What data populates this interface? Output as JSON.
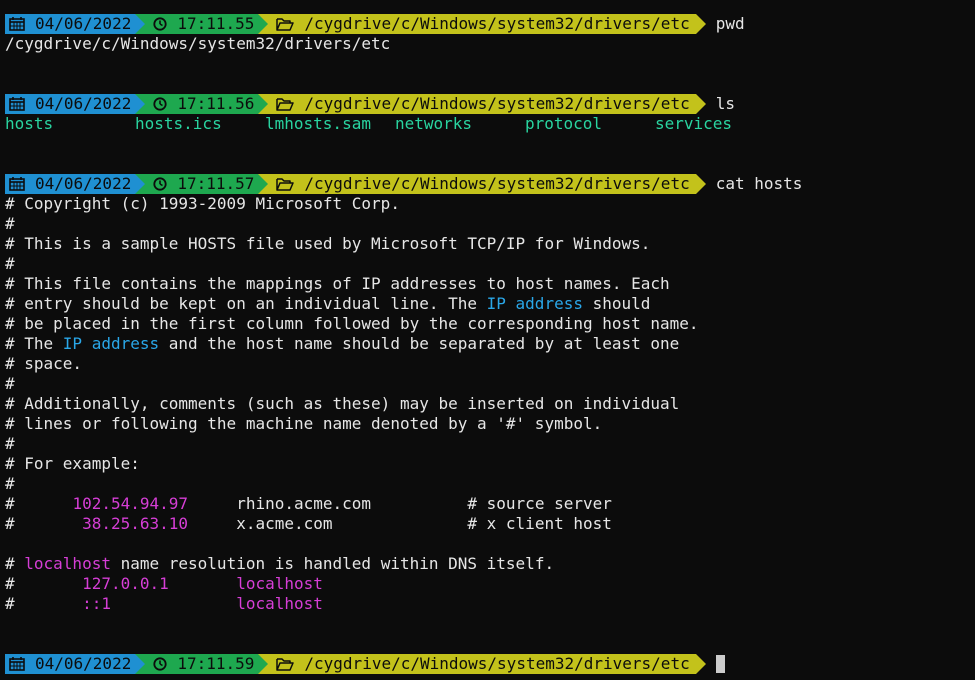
{
  "colors": {
    "date_segment": "#1f90d2",
    "time_segment": "#1ea84f",
    "path_segment": "#c3c21b",
    "file_name": "#29d4a0",
    "ip_highlight": "#2aa7e8",
    "value_highlight": "#d63ed6",
    "background": "#0c0c0c"
  },
  "prompts": [
    {
      "date": "04/06/2022",
      "time": "17:11.55",
      "path": "/cygdrive/c/Windows/system32/drivers/etc",
      "command": "pwd"
    },
    {
      "date": "04/06/2022",
      "time": "17:11.56",
      "path": "/cygdrive/c/Windows/system32/drivers/etc",
      "command": "ls"
    },
    {
      "date": "04/06/2022",
      "time": "17:11.57",
      "path": "/cygdrive/c/Windows/system32/drivers/etc",
      "command": "cat hosts"
    },
    {
      "date": "04/06/2022",
      "time": "17:11.59",
      "path": "/cygdrive/c/Windows/system32/drivers/etc",
      "command": ""
    }
  ],
  "pwd_output": "/cygdrive/c/Windows/system32/drivers/etc",
  "ls_output": [
    "hosts",
    "hosts.ics",
    "lmhosts.sam",
    "networks",
    "protocol",
    "services"
  ],
  "hosts_file": {
    "l1": "# Copyright (c) 1993-2009 Microsoft Corp.",
    "l2": "#",
    "l3": "# This is a sample HOSTS file used by Microsoft TCP/IP for Windows.",
    "l4": "#",
    "l5": "# This file contains the mappings of IP addresses to host names. Each",
    "l6a": "# entry should be kept on an individual line. The ",
    "l6b": "IP address",
    "l6c": " should",
    "l7": "# be placed in the first column followed by the corresponding host name.",
    "l8a": "# The ",
    "l8b": "IP address",
    "l8c": " and the host name should be separated by at least one",
    "l9": "# space.",
    "l10": "#",
    "l11": "# Additionally, comments (such as these) may be inserted on individual",
    "l12": "# lines or following the machine name denoted by a '#' symbol.",
    "l13": "#",
    "l14": "# For example:",
    "l15": "#",
    "l16a": "#      ",
    "l16b": "102.54.94.97",
    "l16c": "     rhino.acme.com          # source server",
    "l17a": "#       ",
    "l17b": "38.25.63.10",
    "l17c": "     x.acme.com              # x client host",
    "l19a": "# ",
    "l19b": "localhost",
    "l19c": " name resolution is handled within DNS itself.",
    "l20a": "#       ",
    "l20b": "127.0.0.1",
    "l20c": "       ",
    "l20d": "localhost",
    "l21a": "#       ",
    "l21b": "::1",
    "l21c": "             ",
    "l21d": "localhost"
  }
}
